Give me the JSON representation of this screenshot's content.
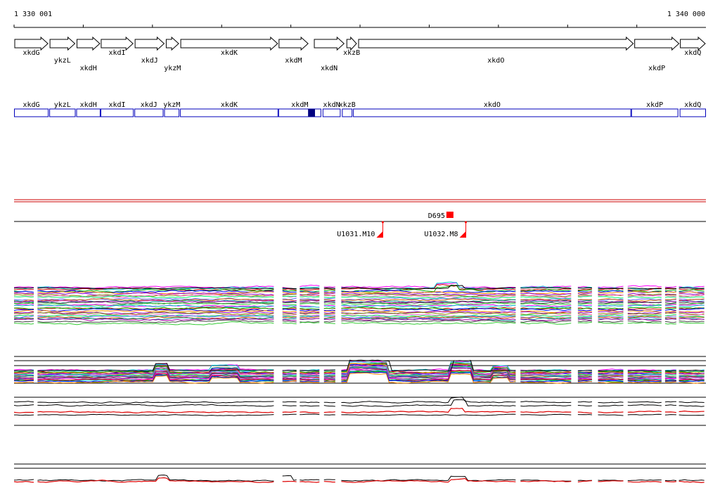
{
  "ruler": {
    "start_label": "1 330 001",
    "end_label": "1 340 000",
    "start": 1330001,
    "end": 1340000
  },
  "genes": [
    {
      "name": "xkdG",
      "start": 1330001,
      "end": 1330500,
      "strand": "+",
      "label_row": 1
    },
    {
      "name": "ykzL",
      "start": 1330510,
      "end": 1330890,
      "strand": "+",
      "label_row": 2
    },
    {
      "name": "xkdH",
      "start": 1330900,
      "end": 1331250,
      "strand": "+",
      "label_row": 3
    },
    {
      "name": "xkdI",
      "start": 1331250,
      "end": 1331730,
      "strand": "+",
      "label_row": 1
    },
    {
      "name": "xkdJ",
      "start": 1331740,
      "end": 1332180,
      "strand": "+",
      "label_row": 2
    },
    {
      "name": "ykzM",
      "start": 1332190,
      "end": 1332390,
      "strand": "+",
      "label_row": 3
    },
    {
      "name": "xkdK",
      "start": 1332400,
      "end": 1333820,
      "strand": "+",
      "label_row": 1
    },
    {
      "name": "xkdM",
      "start": 1333820,
      "end": 1334260,
      "strand": "+",
      "label_row": 2
    },
    {
      "name": "xkdN",
      "start": 1334330,
      "end": 1334780,
      "strand": "+",
      "label_row": 3
    },
    {
      "name": "xkzB",
      "start": 1334800,
      "end": 1334960,
      "strand": "+",
      "label_row": 1
    },
    {
      "name": "xkdO",
      "start": 1334970,
      "end": 1338960,
      "strand": "+",
      "label_row": 2
    },
    {
      "name": "xkdP",
      "start": 1338960,
      "end": 1339620,
      "strand": "+",
      "label_row": 3
    },
    {
      "name": "xkdQ",
      "start": 1339620,
      "end": 1340000,
      "strand": "+",
      "label_row": 1
    }
  ],
  "gene_boxes": [
    {
      "name": "xkdG",
      "start": 1330001,
      "end": 1330500
    },
    {
      "name": "ykzL",
      "start": 1330510,
      "end": 1330890
    },
    {
      "name": "xkdH",
      "start": 1330900,
      "end": 1331250
    },
    {
      "name": "xkdI",
      "start": 1331250,
      "end": 1331730
    },
    {
      "name": "xkdJ",
      "start": 1331740,
      "end": 1332160
    },
    {
      "name": "ykzM",
      "start": 1332170,
      "end": 1332390
    },
    {
      "name": "xkdK",
      "start": 1332400,
      "end": 1333820
    },
    {
      "name": "xkdM",
      "start": 1333820,
      "end": 1334440
    },
    {
      "name": "xkdN",
      "start": 1334460,
      "end": 1334720
    },
    {
      "name": "xkzB",
      "start": 1334740,
      "end": 1334890
    },
    {
      "name": "xkdO",
      "start": 1334900,
      "end": 1338920
    },
    {
      "name": "xkdP",
      "start": 1338920,
      "end": 1339600
    },
    {
      "name": "xkdQ",
      "start": 1339620,
      "end": 1340000
    }
  ],
  "highlight_block": {
    "start": 1334250,
    "end": 1334350
  },
  "markers": [
    {
      "name": "D695",
      "position": 1336300,
      "type": "box"
    },
    {
      "name": "U1031.M10",
      "position": 1335330,
      "type": "flag"
    },
    {
      "name": "U1032.M8",
      "position": 1336530,
      "type": "flag"
    }
  ],
  "tracks": [
    {
      "kind": "multi",
      "name": "profiles-1"
    },
    {
      "kind": "multi",
      "name": "profiles-2"
    },
    {
      "kind": "pair",
      "name": "profiles-3"
    },
    {
      "kind": "pair",
      "name": "profiles-4"
    }
  ],
  "track_gaps": [
    {
      "start": 1330300,
      "end": 1330340
    },
    {
      "start": 1333770,
      "end": 1333810
    },
    {
      "start": 1333850,
      "end": 1333880
    },
    {
      "start": 1334100,
      "end": 1334130
    },
    {
      "start": 1334430,
      "end": 1334480
    },
    {
      "start": 1334680,
      "end": 1334730
    },
    {
      "start": 1337280,
      "end": 1337320
    },
    {
      "start": 1338080,
      "end": 1338130
    },
    {
      "start": 1338130,
      "end": 1338150
    },
    {
      "start": 1338360,
      "end": 1338380
    },
    {
      "start": 1338420,
      "end": 1338440
    },
    {
      "start": 1338840,
      "end": 1338870
    },
    {
      "start": 1339380,
      "end": 1339410
    },
    {
      "start": 1339580,
      "end": 1339610
    }
  ],
  "colors": {
    "gene_stroke": "#000000",
    "box_stroke": "#0000bb",
    "highlight": "#000080",
    "marker": "#ff0000",
    "separator": "#cc0000",
    "pair_a": "#000000",
    "pair_b": "#dd0000"
  }
}
